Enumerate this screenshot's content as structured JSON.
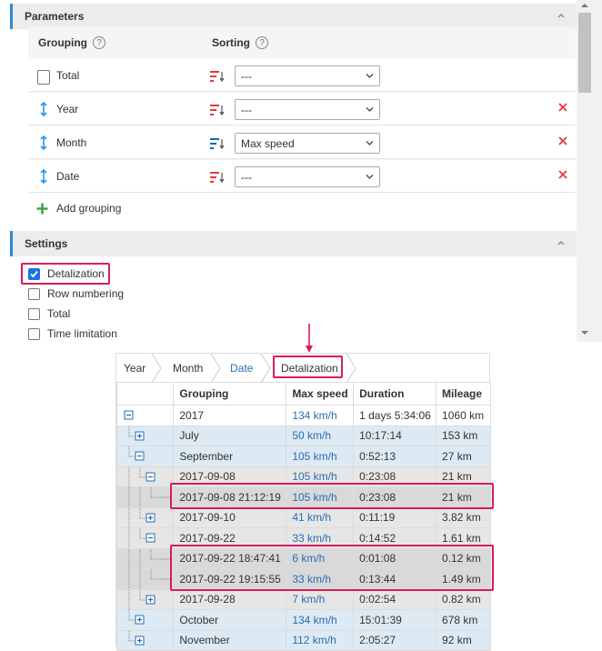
{
  "parameters": {
    "title": "Parameters",
    "grouping_label": "Grouping",
    "sorting_label": "Sorting",
    "help_glyph": "?",
    "rows": [
      {
        "name": "Total",
        "sort_value": "---",
        "lead": "checkbox",
        "sort_active": false,
        "removable": false
      },
      {
        "name": "Year",
        "sort_value": "---",
        "lead": "drag-handle",
        "sort_active": false,
        "removable": true
      },
      {
        "name": "Month",
        "sort_value": "Max speed",
        "lead": "drag-handle",
        "sort_active": true,
        "removable": true
      },
      {
        "name": "Date",
        "sort_value": "---",
        "lead": "drag-handle",
        "sort_active": false,
        "removable": true
      }
    ],
    "add_grouping": "Add grouping"
  },
  "settings": {
    "title": "Settings",
    "options": [
      {
        "label": "Detalization",
        "checked": true
      },
      {
        "label": "Row numbering",
        "checked": false
      },
      {
        "label": "Total",
        "checked": false
      },
      {
        "label": "Time limitation",
        "checked": false
      }
    ]
  },
  "report": {
    "breadcrumb": [
      {
        "label": "Year",
        "link": false
      },
      {
        "label": "Month",
        "link": false
      },
      {
        "label": "Date",
        "link": true
      },
      {
        "label": "Detalization",
        "link": false
      }
    ],
    "columns": [
      "Grouping",
      "Max speed",
      "Duration",
      "Mileage"
    ],
    "rows": [
      {
        "level": 0,
        "toggle": "minus",
        "grouping": "2017",
        "max_speed": "134 km/h",
        "duration": "1 days 5:34:06",
        "mileage": "1060 km"
      },
      {
        "level": 1,
        "toggle": "plus",
        "grouping": "July",
        "max_speed": "50 km/h",
        "duration": "10:17:14",
        "mileage": "153 km"
      },
      {
        "level": 1,
        "toggle": "minus",
        "grouping": "September",
        "max_speed": "105 km/h",
        "duration": "0:52:13",
        "mileage": "27 km"
      },
      {
        "level": 2,
        "toggle": "minus",
        "grouping": "2017-09-08",
        "max_speed": "105 km/h",
        "duration": "0:23:08",
        "mileage": "21 km"
      },
      {
        "level": 3,
        "toggle": "none",
        "grouping": "2017-09-08 21:12:19",
        "max_speed": "105 km/h",
        "duration": "0:23:08",
        "mileage": "21 km"
      },
      {
        "level": 2,
        "toggle": "plus",
        "grouping": "2017-09-10",
        "max_speed": "41 km/h",
        "duration": "0:11:19",
        "mileage": "3.82 km"
      },
      {
        "level": 2,
        "toggle": "minus",
        "grouping": "2017-09-22",
        "max_speed": "33 km/h",
        "duration": "0:14:52",
        "mileage": "1.61 km"
      },
      {
        "level": 3,
        "toggle": "none",
        "grouping": "2017-09-22 18:47:41",
        "max_speed": "6 km/h",
        "duration": "0:01:08",
        "mileage": "0.12 km"
      },
      {
        "level": 3,
        "toggle": "none",
        "grouping": "2017-09-22 19:15:55",
        "max_speed": "33 km/h",
        "duration": "0:13:44",
        "mileage": "1.49 km"
      },
      {
        "level": 2,
        "toggle": "plus",
        "grouping": "2017-09-28",
        "max_speed": "7 km/h",
        "duration": "0:02:54",
        "mileage": "0.82 km"
      },
      {
        "level": 1,
        "toggle": "plus",
        "grouping": "October",
        "max_speed": "134 km/h",
        "duration": "15:01:39",
        "mileage": "678 km"
      },
      {
        "level": 1,
        "toggle": "plus",
        "grouping": "November",
        "max_speed": "112 km/h",
        "duration": "2:05:27",
        "mileage": "92 km"
      }
    ]
  },
  "colors": {
    "accent_blue": "#2e89d6",
    "highlight": "#d81b60",
    "delete_red": "#e53935",
    "add_green": "#43a047",
    "sort_inactive": "#e53935",
    "sort_active": "#1565c0"
  }
}
